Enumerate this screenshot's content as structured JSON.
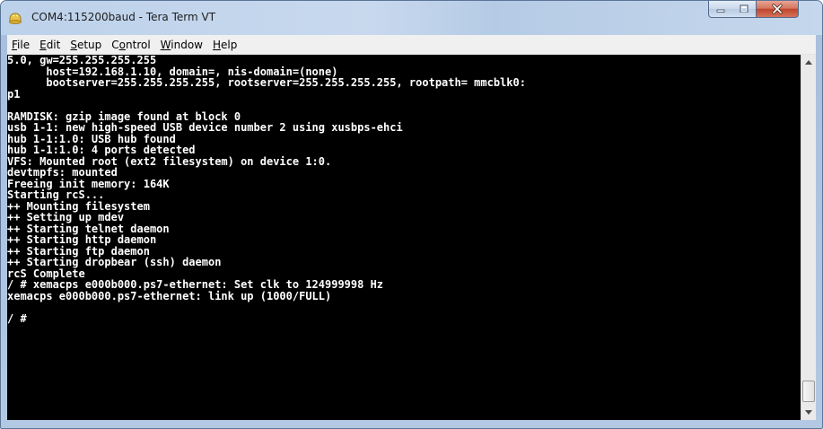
{
  "window": {
    "title": "COM4:115200baud - Tera Term VT",
    "app_icon": "teraterm-icon",
    "controls": {
      "minimize_icon": "minimize-icon",
      "maximize_icon": "maximize-icon",
      "close_icon": "close-icon"
    }
  },
  "menu": [
    {
      "underline": "F",
      "rest": "ile"
    },
    {
      "underline": "E",
      "rest": "dit"
    },
    {
      "underline": "S",
      "rest": "etup"
    },
    {
      "pre": "C",
      "underline": "o",
      "rest": "ntrol"
    },
    {
      "underline": "W",
      "rest": "indow"
    },
    {
      "underline": "H",
      "rest": "elp"
    }
  ],
  "terminal": {
    "lines": [
      "5.0, gw=255.255.255.255",
      "      host=192.168.1.10, domain=, nis-domain=(none)",
      "      bootserver=255.255.255.255, rootserver=255.255.255.255, rootpath= mmcblk0:",
      "p1",
      "",
      "RAMDISK: gzip image found at block 0",
      "usb 1-1: new high-speed USB device number 2 using xusbps-ehci",
      "hub 1-1:1.0: USB hub found",
      "hub 1-1:1.0: 4 ports detected",
      "VFS: Mounted root (ext2 filesystem) on device 1:0.",
      "devtmpfs: mounted",
      "Freeing init memory: 164K",
      "Starting rcS...",
      "++ Mounting filesystem",
      "++ Setting up mdev",
      "++ Starting telnet daemon",
      "++ Starting http daemon",
      "++ Starting ftp daemon",
      "++ Starting dropbear (ssh) daemon",
      "rcS Complete",
      "/ # xemacps e000b000.ps7-ethernet: Set clk to 124999998 Hz",
      "xemacps e000b000.ps7-ethernet: link up (1000/FULL)",
      "",
      "/ #"
    ],
    "colors": {
      "background": "#000000",
      "foreground": "#ffffff"
    }
  },
  "scrollbar": {
    "up_icon": "scroll-up-arrow-icon",
    "down_icon": "scroll-down-arrow-icon"
  }
}
